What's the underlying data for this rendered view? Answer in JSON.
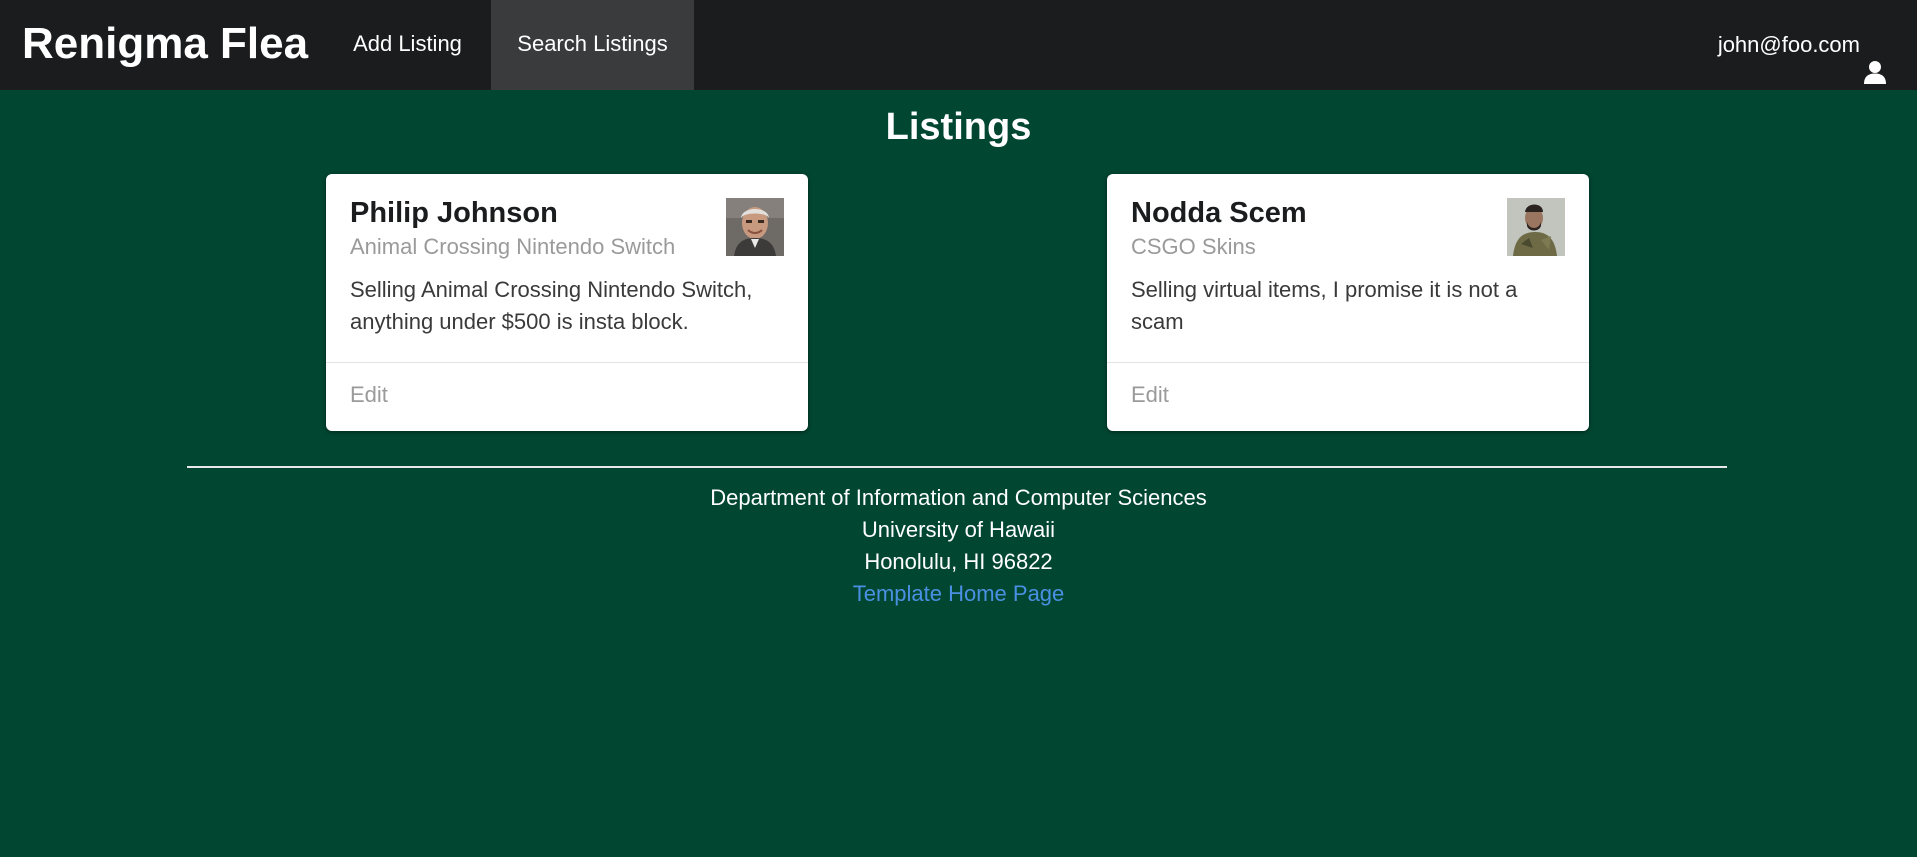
{
  "navbar": {
    "brand": "Renigma Flea",
    "items": [
      {
        "label": "Add Listing"
      },
      {
        "label": "Search Listings"
      }
    ],
    "user": {
      "email": "john@foo.com",
      "icon": "user-icon"
    }
  },
  "main": {
    "title": "Listings",
    "listings": [
      {
        "name": "Philip Johnson",
        "item": "Animal Crossing Nintendo Switch",
        "description": "Selling Animal Crossing Nintendo Switch, anything under $500 is insta block.",
        "edit_label": "Edit"
      },
      {
        "name": "Nodda Scem",
        "item": "CSGO Skins",
        "description": "Selling virtual items, I promise it is not a scam",
        "edit_label": "Edit"
      }
    ]
  },
  "footer": {
    "line1": "Department of Information and Computer Sciences",
    "line2": "University of Hawaii",
    "line3": "Honolulu, HI 96822",
    "link": "Template Home Page"
  },
  "colors": {
    "background": "#014631",
    "navbar": "#1b1c1d",
    "active_nav": "#3a3b3c",
    "link": "#4a90e2"
  }
}
